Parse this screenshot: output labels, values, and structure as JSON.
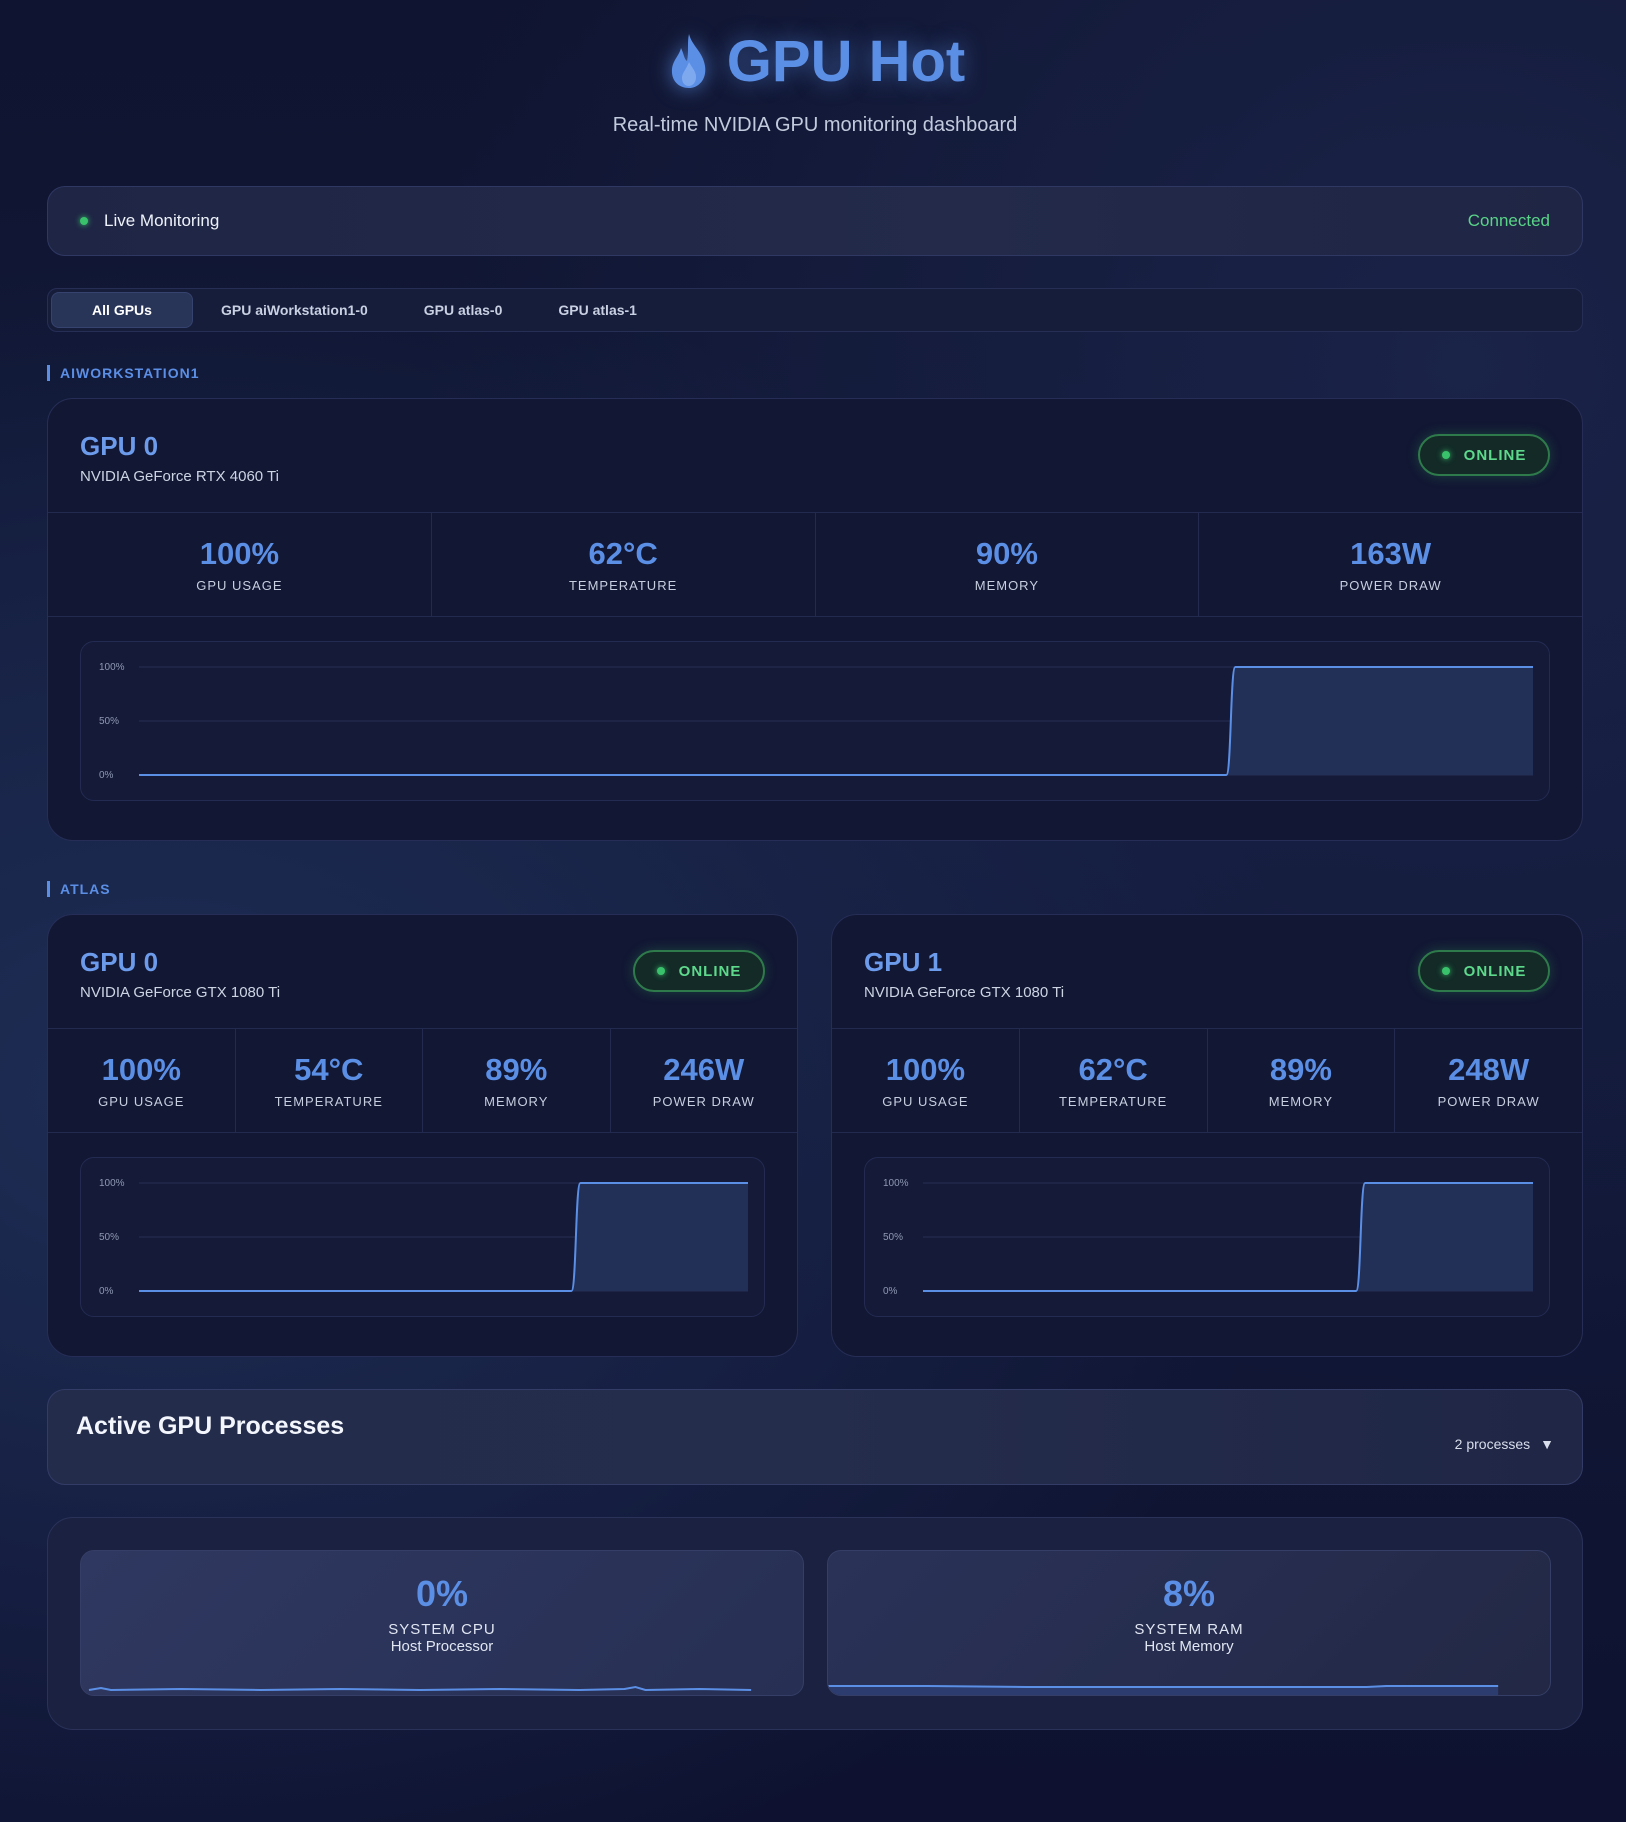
{
  "header": {
    "title": "GPU Hot",
    "subtitle": "Real-time NVIDIA GPU monitoring dashboard",
    "icon": "flame-icon"
  },
  "status": {
    "label": "Live Monitoring",
    "connection": "Connected"
  },
  "tabs": [
    {
      "label": "All GPUs",
      "active": true
    },
    {
      "label": "GPU aiWorkstation1-0",
      "active": false
    },
    {
      "label": "GPU atlas-0",
      "active": false
    },
    {
      "label": "GPU atlas-1",
      "active": false
    }
  ],
  "hosts": [
    {
      "name": "AIWORKSTATION1",
      "gpus": [
        {
          "title": "GPU 0",
          "model": "NVIDIA GeForce RTX 4060 Ti",
          "status": "ONLINE",
          "metrics": [
            {
              "value": "100%",
              "label": "GPU USAGE"
            },
            {
              "value": "62°C",
              "label": "TEMPERATURE"
            },
            {
              "value": "90%",
              "label": "MEMORY"
            },
            {
              "value": "163W",
              "label": "POWER DRAW"
            }
          ],
          "chart": {
            "ticks": [
              "100%",
              "50%",
              "0%"
            ],
            "step_fraction": 0.78,
            "before": 0,
            "after": 100
          }
        }
      ]
    },
    {
      "name": "ATLAS",
      "gpus": [
        {
          "title": "GPU 0",
          "model": "NVIDIA GeForce GTX 1080 Ti",
          "status": "ONLINE",
          "metrics": [
            {
              "value": "100%",
              "label": "GPU USAGE"
            },
            {
              "value": "54°C",
              "label": "TEMPERATURE"
            },
            {
              "value": "89%",
              "label": "MEMORY"
            },
            {
              "value": "246W",
              "label": "POWER DRAW"
            }
          ],
          "chart": {
            "ticks": [
              "100%",
              "50%",
              "0%"
            ],
            "step_fraction": 0.71,
            "before": 0,
            "after": 100
          }
        },
        {
          "title": "GPU 1",
          "model": "NVIDIA GeForce GTX 1080 Ti",
          "status": "ONLINE",
          "metrics": [
            {
              "value": "100%",
              "label": "GPU USAGE"
            },
            {
              "value": "62°C",
              "label": "TEMPERATURE"
            },
            {
              "value": "89%",
              "label": "MEMORY"
            },
            {
              "value": "248W",
              "label": "POWER DRAW"
            }
          ],
          "chart": {
            "ticks": [
              "100%",
              "50%",
              "0%"
            ],
            "step_fraction": 0.71,
            "before": 0,
            "after": 100
          }
        }
      ]
    }
  ],
  "processes": {
    "title": "Active GPU Processes",
    "count": "2 processes",
    "toggle_glyph": "▼"
  },
  "system": {
    "cpu": {
      "value": "0%",
      "label": "SYSTEM CPU",
      "sub": "Host Processor"
    },
    "ram": {
      "value": "8%",
      "label": "SYSTEM RAM",
      "sub": "Host Memory"
    }
  },
  "colors": {
    "accent": "#5b8fe6",
    "online": "#5ed98c",
    "connected": "#58d487",
    "background": "#121a3a"
  }
}
